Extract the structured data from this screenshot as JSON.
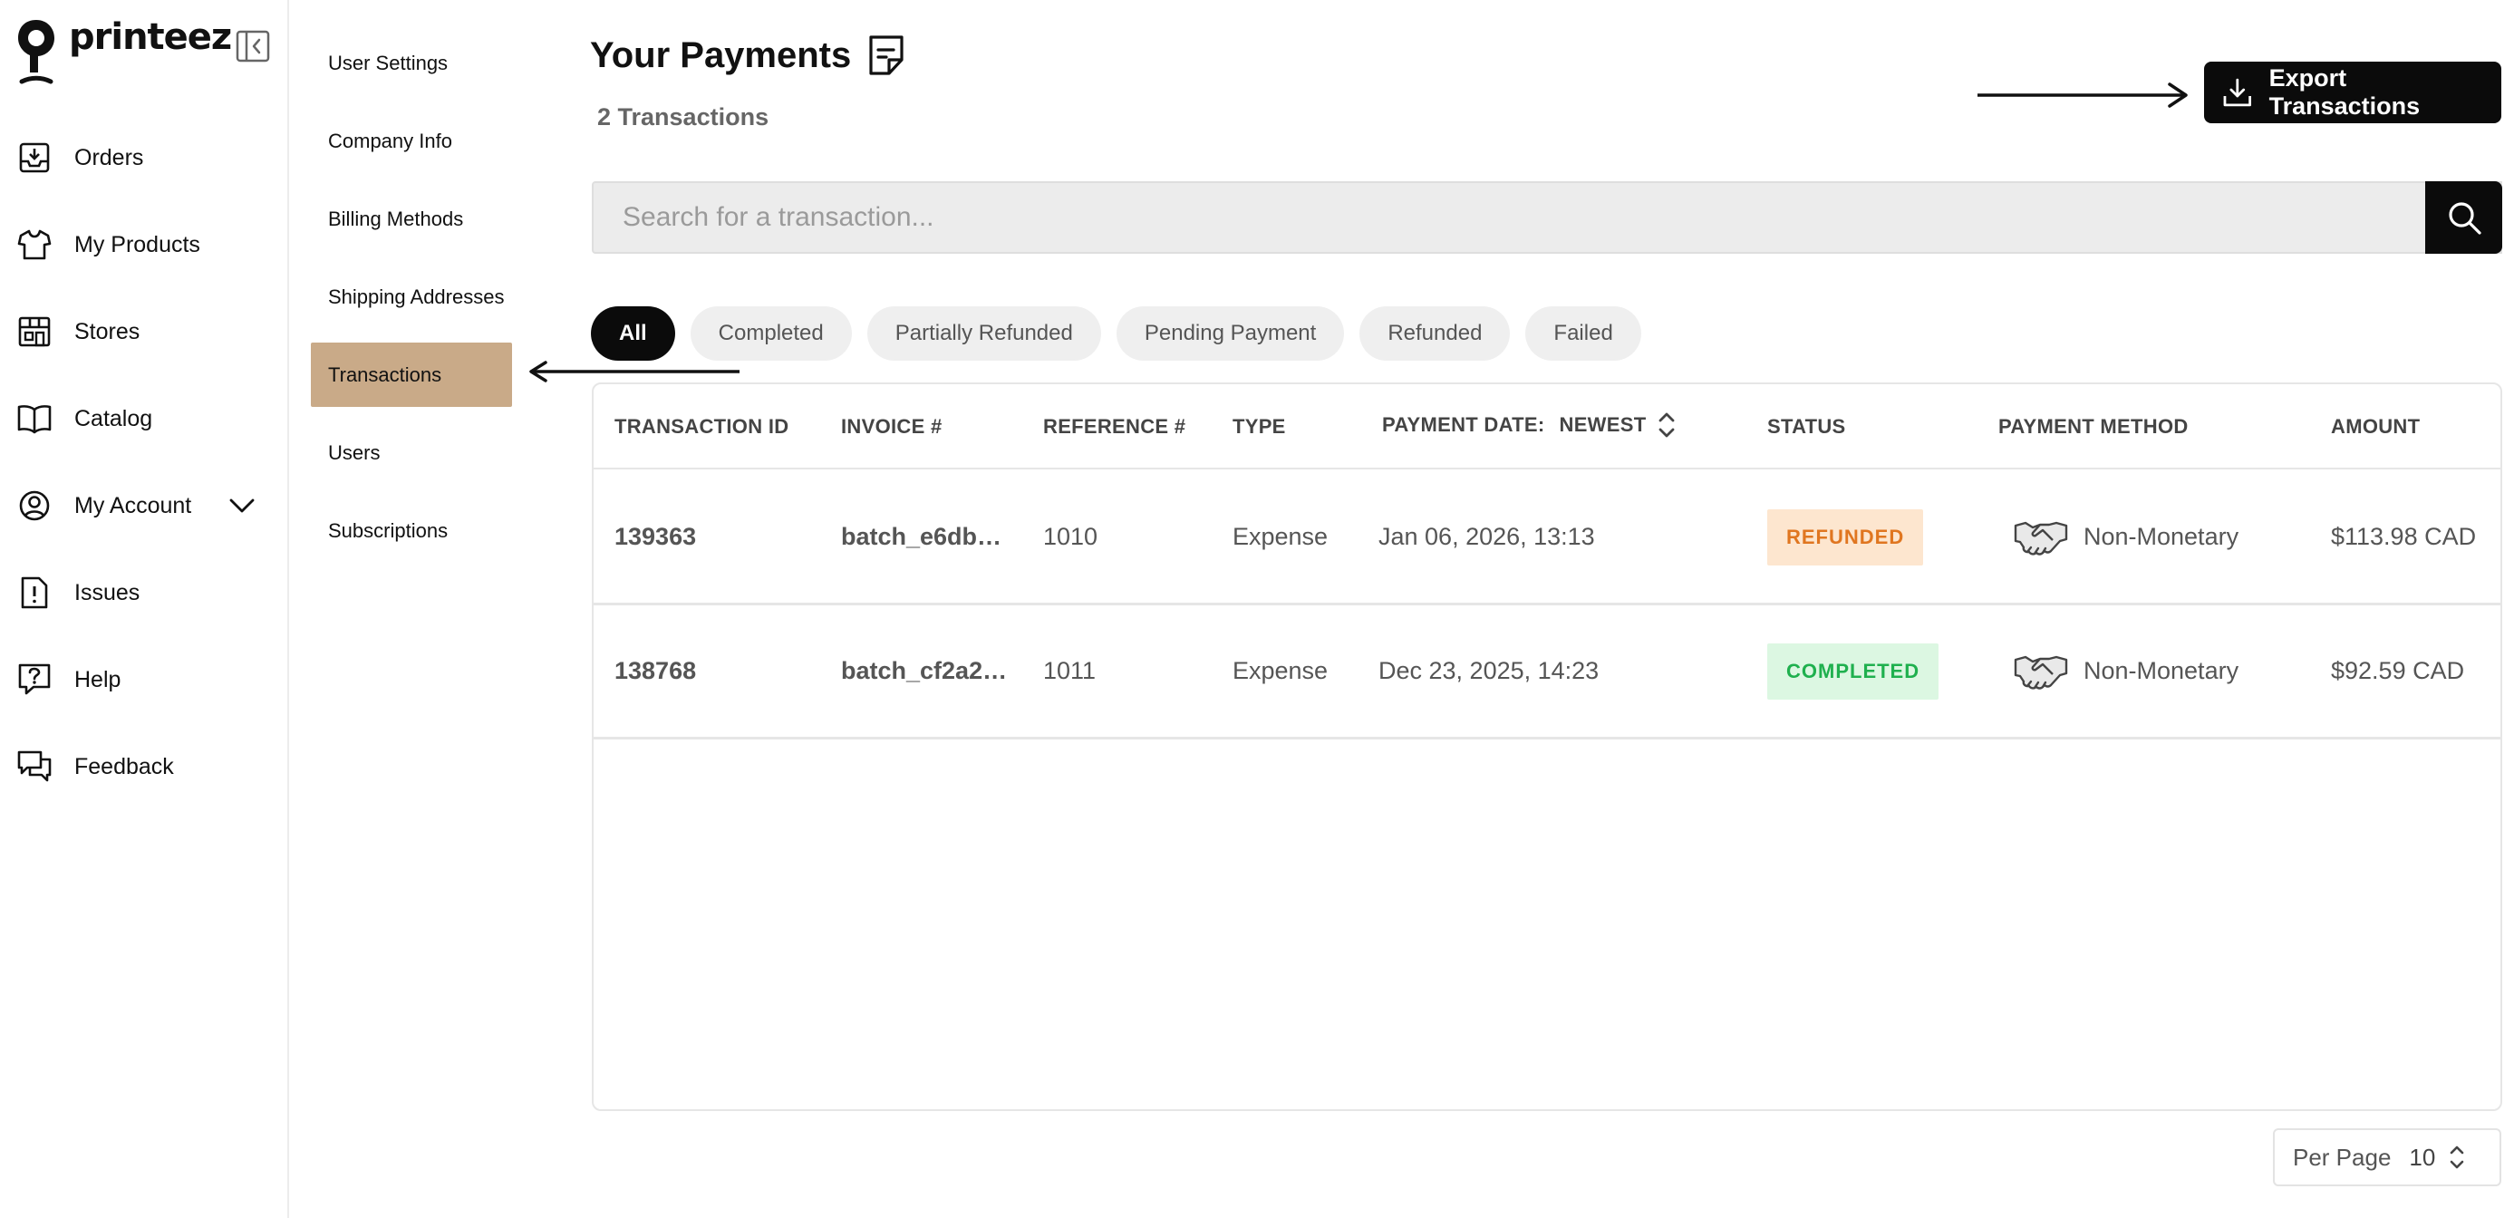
{
  "brand": {
    "name": "printeez"
  },
  "sidebar": {
    "items": [
      {
        "label": "Orders",
        "icon": "inbox-download-icon"
      },
      {
        "label": "My Products",
        "icon": "tshirt-icon"
      },
      {
        "label": "Stores",
        "icon": "store-icon"
      },
      {
        "label": "Catalog",
        "icon": "book-icon"
      },
      {
        "label": "My Account",
        "icon": "user-circle-icon"
      },
      {
        "label": "Issues",
        "icon": "alert-file-icon"
      },
      {
        "label": "Help",
        "icon": "help-chat-icon"
      },
      {
        "label": "Feedback",
        "icon": "feedback-chat-icon"
      }
    ]
  },
  "subnav": {
    "items": [
      {
        "label": "User Settings"
      },
      {
        "label": "Company Info"
      },
      {
        "label": "Billing Methods"
      },
      {
        "label": "Shipping Addresses"
      },
      {
        "label": "Transactions",
        "active": true
      },
      {
        "label": "Users"
      },
      {
        "label": "Subscriptions"
      }
    ]
  },
  "header": {
    "title": "Your Payments",
    "count_text": "2 Transactions",
    "export_label": "Export Transactions"
  },
  "search": {
    "placeholder": "Search for a transaction..."
  },
  "filters": [
    "All",
    "Completed",
    "Partially Refunded",
    "Pending Payment",
    "Refunded",
    "Failed"
  ],
  "table": {
    "columns": {
      "transaction_id": "TRANSACTION ID",
      "invoice": "INVOICE #",
      "reference": "REFERENCE #",
      "type": "TYPE",
      "payment_date": "PAYMENT DATE:",
      "payment_date_sort": "NEWEST",
      "status": "STATUS",
      "payment_method": "PAYMENT METHOD",
      "amount": "AMOUNT"
    },
    "rows": [
      {
        "id": "139363",
        "invoice": "batch_e6db…",
        "reference": "1010",
        "type": "Expense",
        "date": "Jan 06, 2026, 13:13",
        "status": "REFUNDED",
        "method": "Non-Monetary",
        "amount": "$113.98 CAD"
      },
      {
        "id": "138768",
        "invoice": "batch_cf2a2…",
        "reference": "1011",
        "type": "Expense",
        "date": "Dec 23, 2025, 14:23",
        "status": "COMPLETED",
        "method": "Non-Monetary",
        "amount": "$92.59 CAD"
      }
    ]
  },
  "pagination": {
    "per_page_label": "Per Page",
    "per_page_value": "10"
  },
  "colors": {
    "accent_active": "#c9aa88",
    "button_dark": "#0b0b0b",
    "refunded_bg": "#fde6cf",
    "refunded_text": "#e07620",
    "completed_bg": "#dcf7e2",
    "completed_text": "#1fb04e"
  }
}
